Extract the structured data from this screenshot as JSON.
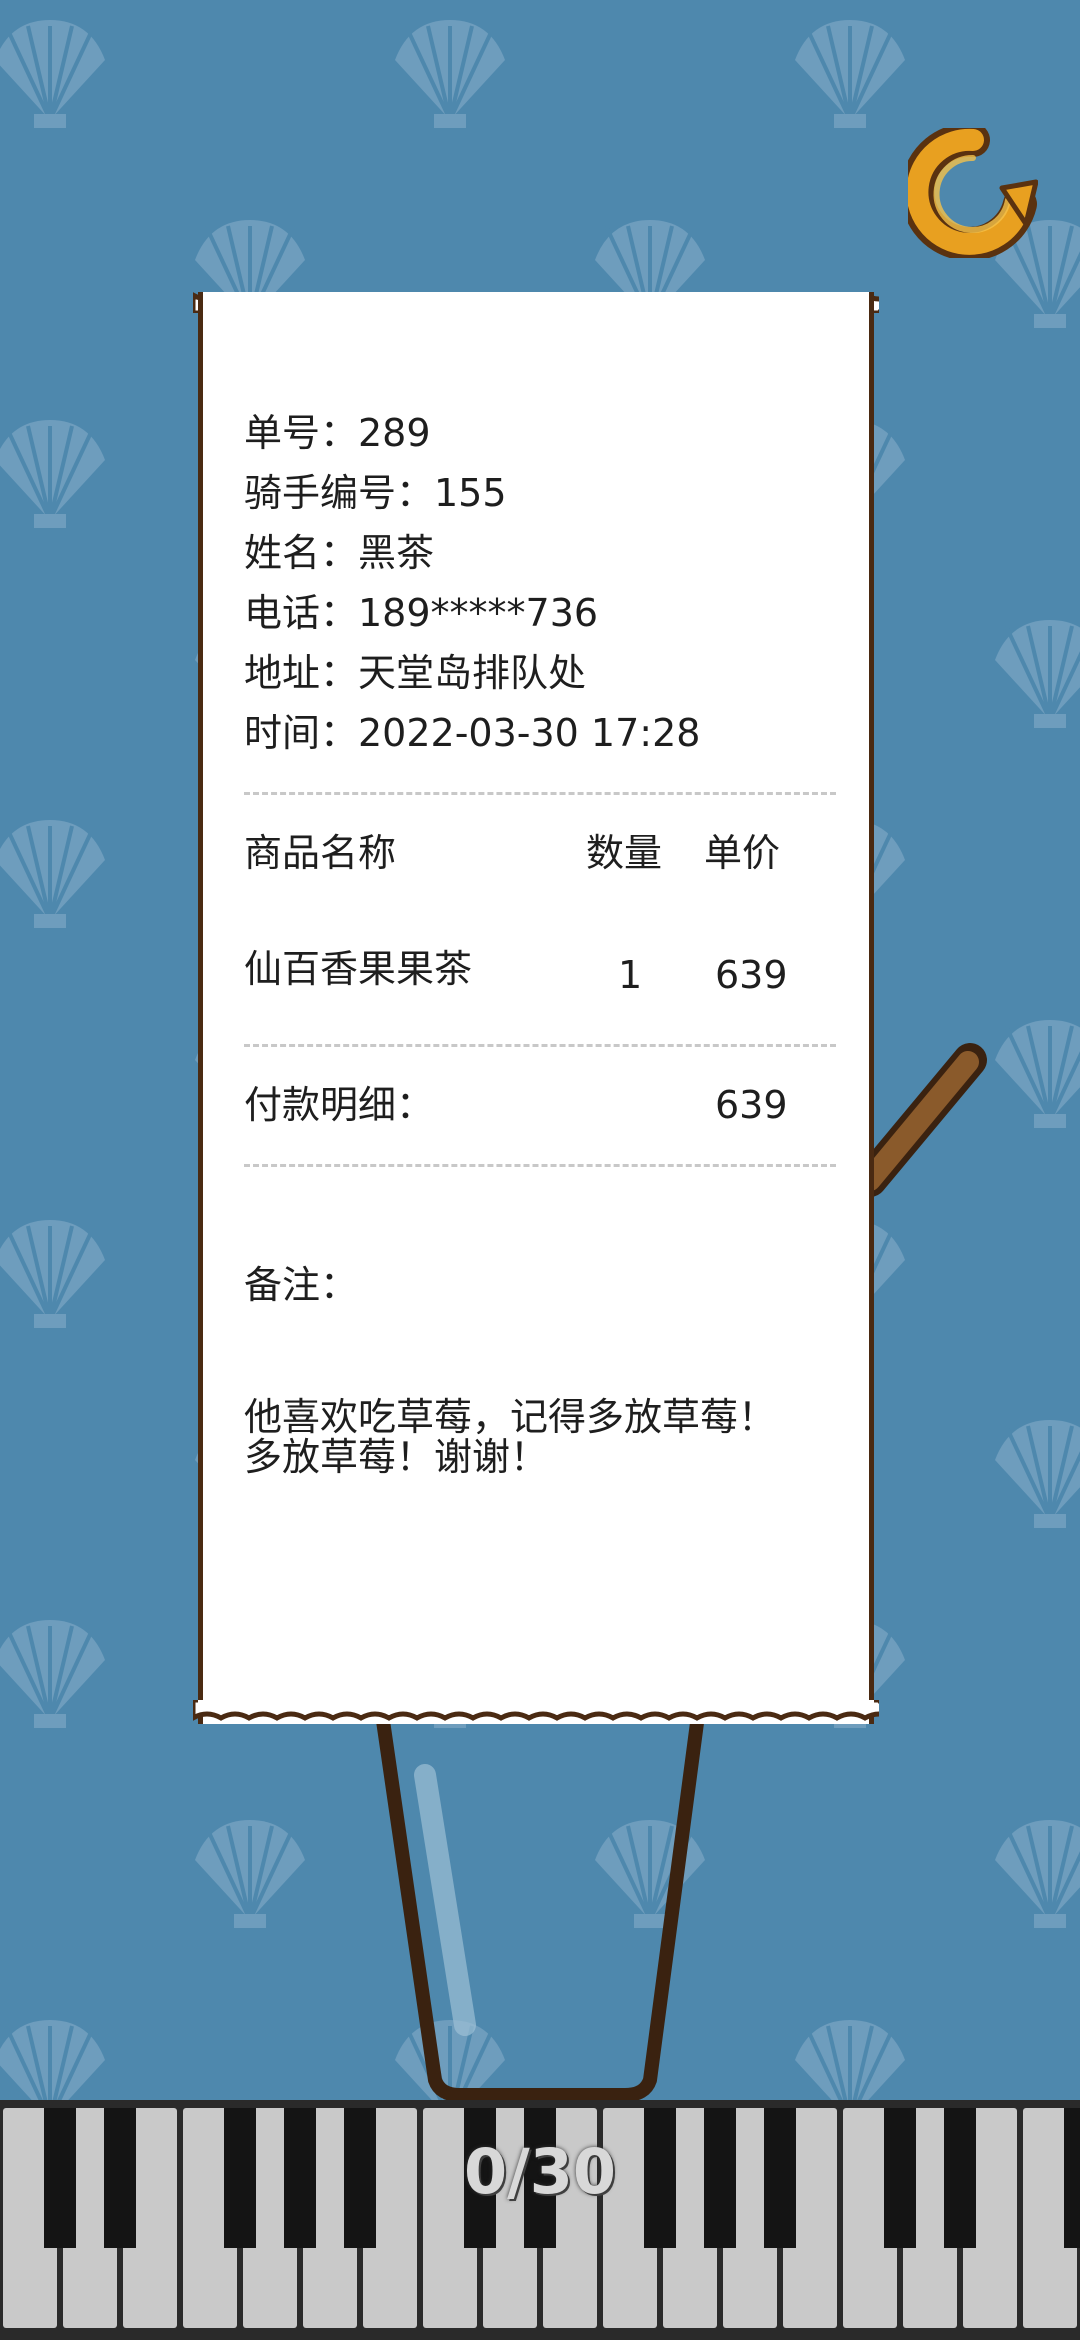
{
  "receipt": {
    "order_no": "单号：289",
    "rider_no": "骑手编号：155",
    "name": "姓名：黑茶",
    "phone": "电话：189*****736",
    "address": "地址：天堂岛排队处",
    "time": "时间：2022-03-30 17:28",
    "headers": {
      "name": "商品名称",
      "qty": "数量",
      "price": "单价"
    },
    "items": [
      {
        "name": "仙百香果果茶",
        "qty": "1",
        "price": "639"
      }
    ],
    "payment_label": "付款明细：",
    "payment_total": "639",
    "remark_label": "备注：",
    "remark_line1": "他喜欢吃草莓，记得多放草莓！",
    "remark_line2": "多放草莓！谢谢！"
  },
  "score": "0/30",
  "colors": {
    "background": "#4e88ad",
    "shell_pattern": "#6e9dbd",
    "receipt_border": "#4a2a12",
    "restart_orange": "#e8a020",
    "straw": "#8a5a2b"
  },
  "icons": {
    "restart": "restart-arrow-icon"
  }
}
